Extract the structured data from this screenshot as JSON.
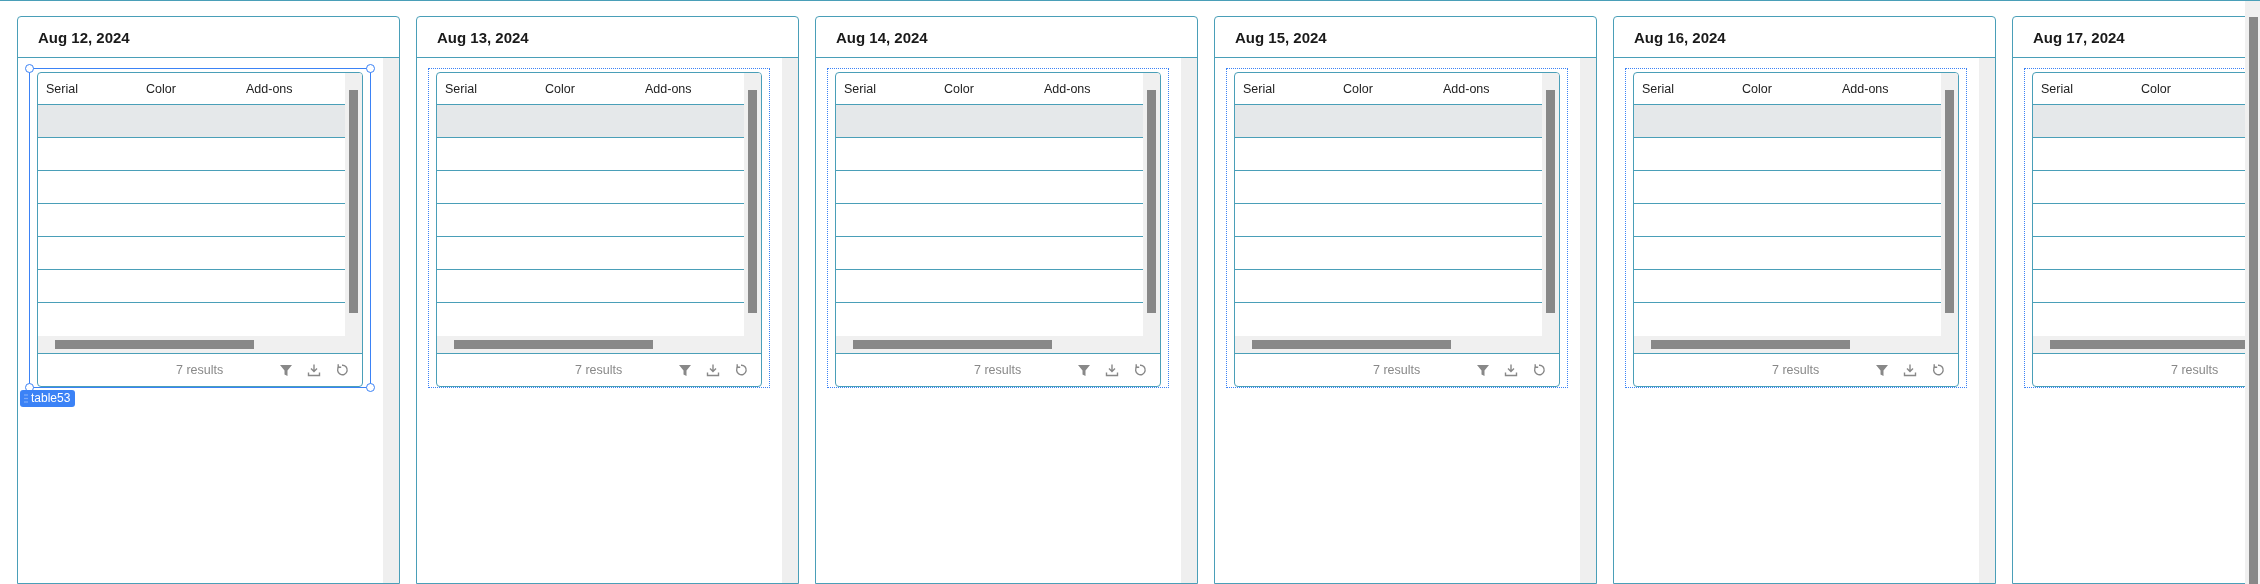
{
  "days": [
    {
      "date": "Aug 12, 2024",
      "table": {
        "selected": true,
        "label": "table53",
        "columns": [
          "Serial",
          "Color",
          "Add-ons"
        ],
        "rows": [
          {
            "selected": true
          },
          {
            "selected": false
          },
          {
            "selected": false
          },
          {
            "selected": false
          },
          {
            "selected": false
          },
          {
            "selected": false
          },
          {
            "selected": false
          }
        ],
        "footer": "7 results",
        "tools": [
          {
            "kind": "filter"
          },
          {
            "kind": "download"
          },
          {
            "kind": "refresh"
          }
        ]
      }
    },
    {
      "date": "Aug 13, 2024",
      "table": {
        "selected": false,
        "columns": [
          "Serial",
          "Color",
          "Add-ons"
        ],
        "rows": [
          {
            "selected": true
          },
          {
            "selected": false
          },
          {
            "selected": false
          },
          {
            "selected": false
          },
          {
            "selected": false
          },
          {
            "selected": false
          },
          {
            "selected": false
          }
        ],
        "footer": "7 results",
        "tools": [
          {
            "kind": "filter"
          },
          {
            "kind": "download"
          },
          {
            "kind": "refresh"
          }
        ]
      }
    },
    {
      "date": "Aug 14, 2024",
      "table": {
        "selected": false,
        "columns": [
          "Serial",
          "Color",
          "Add-ons"
        ],
        "rows": [
          {
            "selected": true
          },
          {
            "selected": false
          },
          {
            "selected": false
          },
          {
            "selected": false
          },
          {
            "selected": false
          },
          {
            "selected": false
          },
          {
            "selected": false
          }
        ],
        "footer": "7 results",
        "tools": [
          {
            "kind": "filter"
          },
          {
            "kind": "download"
          },
          {
            "kind": "refresh"
          }
        ]
      }
    },
    {
      "date": "Aug 15, 2024",
      "table": {
        "selected": false,
        "columns": [
          "Serial",
          "Color",
          "Add-ons"
        ],
        "rows": [
          {
            "selected": true
          },
          {
            "selected": false
          },
          {
            "selected": false
          },
          {
            "selected": false
          },
          {
            "selected": false
          },
          {
            "selected": false
          },
          {
            "selected": false
          }
        ],
        "footer": "7 results",
        "tools": [
          {
            "kind": "filter"
          },
          {
            "kind": "download"
          },
          {
            "kind": "refresh"
          }
        ]
      }
    },
    {
      "date": "Aug 16, 2024",
      "table": {
        "selected": false,
        "columns": [
          "Serial",
          "Color",
          "Add-ons"
        ],
        "rows": [
          {
            "selected": true
          },
          {
            "selected": false
          },
          {
            "selected": false
          },
          {
            "selected": false
          },
          {
            "selected": false
          },
          {
            "selected": false
          },
          {
            "selected": false
          }
        ],
        "footer": "7 results",
        "tools": [
          {
            "kind": "filter"
          },
          {
            "kind": "download"
          },
          {
            "kind": "refresh"
          }
        ]
      }
    },
    {
      "date": "Aug 17, 2024",
      "table": {
        "selected": false,
        "columns": [
          "Serial",
          "Color"
        ],
        "rows": [
          {
            "selected": true
          },
          {
            "selected": false
          },
          {
            "selected": false
          },
          {
            "selected": false
          },
          {
            "selected": false
          },
          {
            "selected": false
          },
          {
            "selected": false
          }
        ],
        "footer": "7 results"
      }
    }
  ]
}
